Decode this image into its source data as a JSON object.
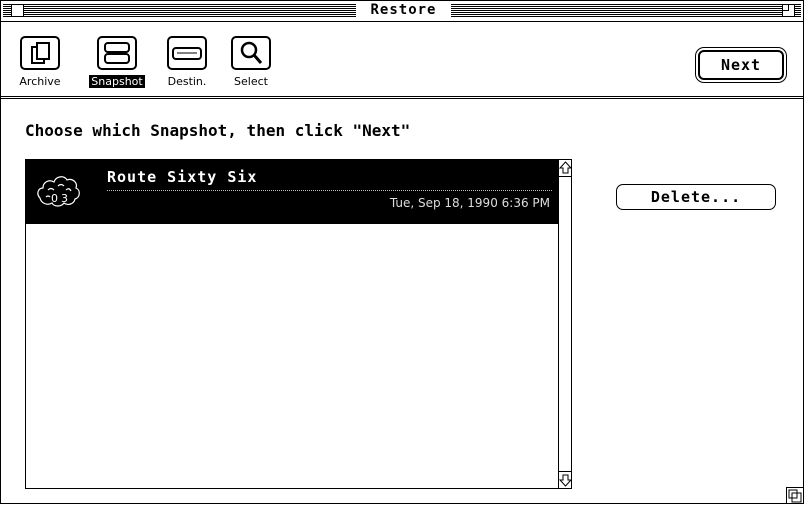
{
  "window": {
    "title": "Restore"
  },
  "toolbar": {
    "tools": [
      {
        "label": "Archive",
        "icon": "archive-icon",
        "selected": false
      },
      {
        "label": "Snapshot",
        "icon": "snapshot-icon",
        "selected": true
      },
      {
        "label": "Destin.",
        "icon": "destination-icon",
        "selected": false
      },
      {
        "label": "Select",
        "icon": "magnifier-icon",
        "selected": false
      }
    ],
    "next_label": "Next"
  },
  "main": {
    "instruction": "Choose which Snapshot, then click \"Next\"",
    "snapshots": [
      {
        "name": "Route Sixty Six",
        "date": "Tue, Sep 18, 1990  6:36 PM",
        "selected": true
      }
    ],
    "delete_label": "Delete..."
  }
}
